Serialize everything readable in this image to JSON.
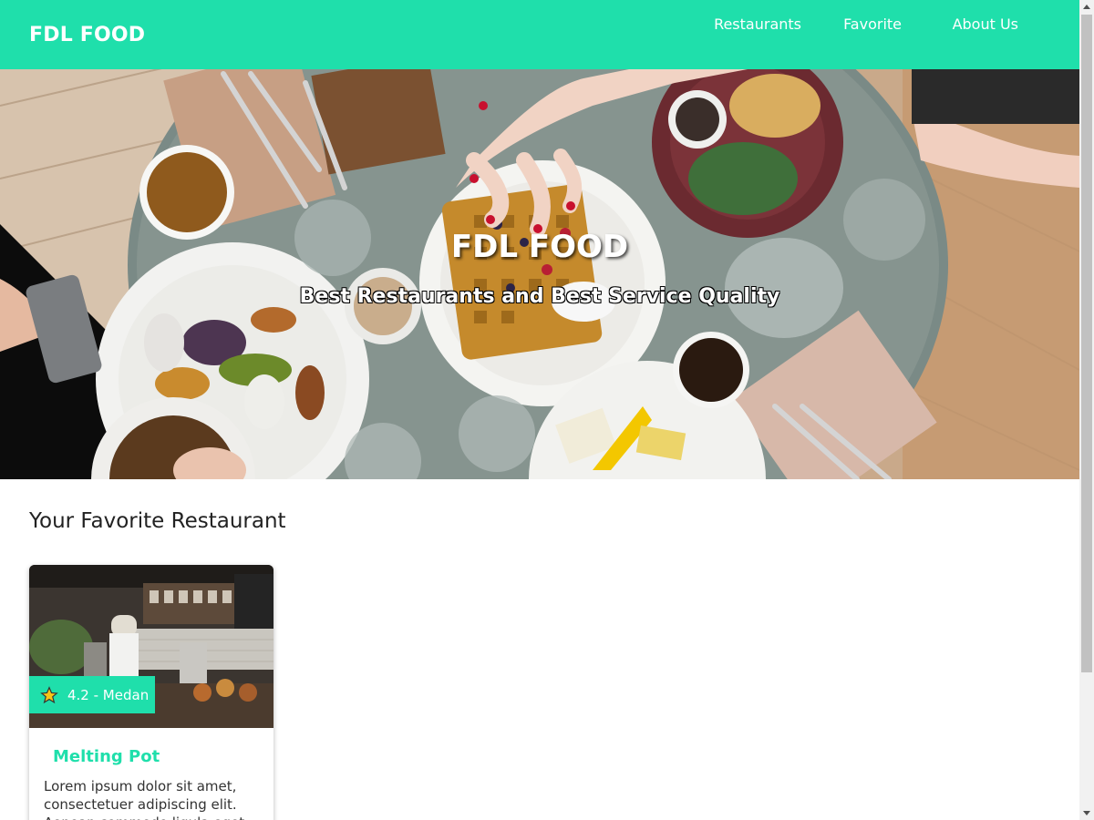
{
  "header": {
    "brand": "FDL FOOD",
    "nav": [
      "Restaurants",
      "Favorite",
      "About Us"
    ]
  },
  "hero": {
    "title": "FDL FOOD",
    "subtitle": "Best Restaurants and Best Service Quality"
  },
  "main": {
    "section_title": "Your Favorite Restaurant",
    "cards": [
      {
        "rating_location": "4.2 - Medan",
        "name": "Melting Pot",
        "description": "Lorem ipsum dolor sit amet, consectetuer adipiscing elit. Aenean commodo ligula eget"
      }
    ]
  },
  "colors": {
    "accent": "#1fdfab"
  },
  "icons": {
    "rating": "star-icon"
  }
}
